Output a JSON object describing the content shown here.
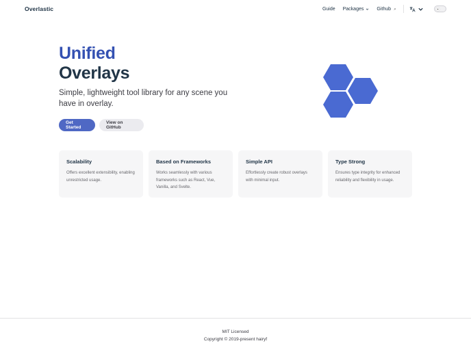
{
  "nav": {
    "brand": "Overlastic",
    "links": [
      {
        "label": "Guide"
      },
      {
        "label": "Packages"
      },
      {
        "label": "Github"
      }
    ]
  },
  "hero": {
    "name": "Unified",
    "text": "Overlays",
    "tagline": "Simple, lightweight tool library for any scene you have in overlay.",
    "actions": [
      {
        "label": "Get Started"
      },
      {
        "label": "View on GitHub"
      }
    ]
  },
  "features": [
    {
      "title": "Scalability",
      "details": "Offers excellent extensibility, enabling unrestricted usage."
    },
    {
      "title": "Based on Frameworks",
      "details": "Works seamlessly with various frameworks such as React, Vue, Vanilla, and Svelte."
    },
    {
      "title": "Simple API",
      "details": "Effortlessly create robust overlays with minimal input."
    },
    {
      "title": "Type Strong",
      "details": "Ensures type integrity for enhanced reliability and flexibility in usage."
    }
  ],
  "footer": {
    "message": "MIT Licensed",
    "copyright": "Copyright © 2019-present hairyf"
  },
  "colors": {
    "brand": "#3451b2",
    "button_brand": "#4f68c4",
    "hexagon": "#4a6ad2"
  },
  "icons": {
    "language": "translate-icon",
    "theme": "sun-icon"
  }
}
